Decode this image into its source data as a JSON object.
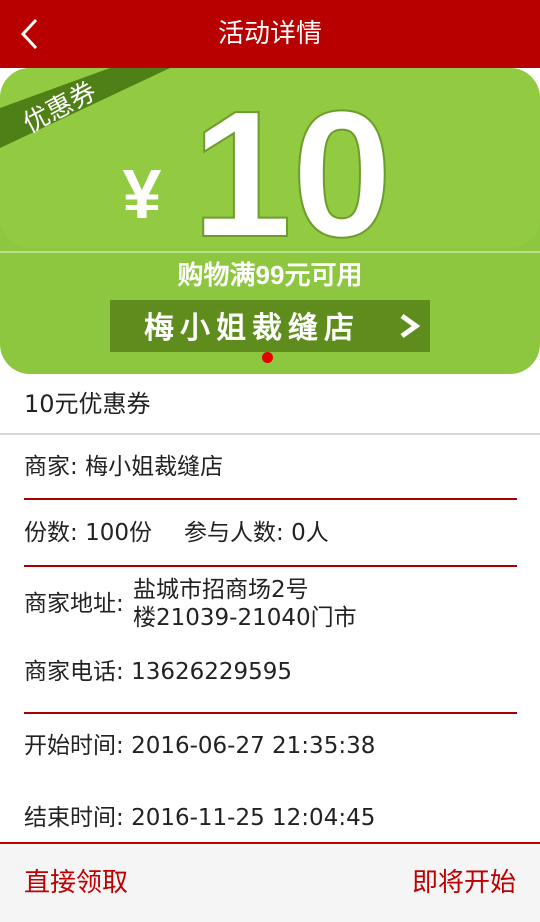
{
  "header": {
    "title": "活动详情"
  },
  "banner": {
    "ribbon": "优惠券",
    "currency": "¥",
    "amount": "10",
    "condition": "购物满99元可用",
    "shop_name": "梅小姐裁缝店",
    "arrow": "›",
    "colors": {
      "green": "#8dc63f",
      "dark_green": "#5e8d1e",
      "ribbon": "#4f7f17"
    }
  },
  "coupon": {
    "title": "10元优惠券"
  },
  "details": {
    "merchant_label": "商家:",
    "merchant_value": "梅小姐裁缝店",
    "quantity_label": "份数:",
    "quantity_value": "100份",
    "participants_label": "参与人数:",
    "participants_value": "0人",
    "address_label": "商家地址:",
    "address_line1": "盐城市招商场2号",
    "address_line2": "楼21039-21040门市",
    "phone_label": "商家电话:",
    "phone_value": "13626229595",
    "start_label": "开始时间:",
    "start_value": "2016-06-27 21:35:38",
    "end_label": "结束时间:",
    "end_value": "2016-11-25 12:04:45"
  },
  "actions": {
    "claim": "直接领取",
    "status": "即将开始"
  },
  "theme": {
    "primary": "#b80000",
    "accent": "#c00000"
  }
}
